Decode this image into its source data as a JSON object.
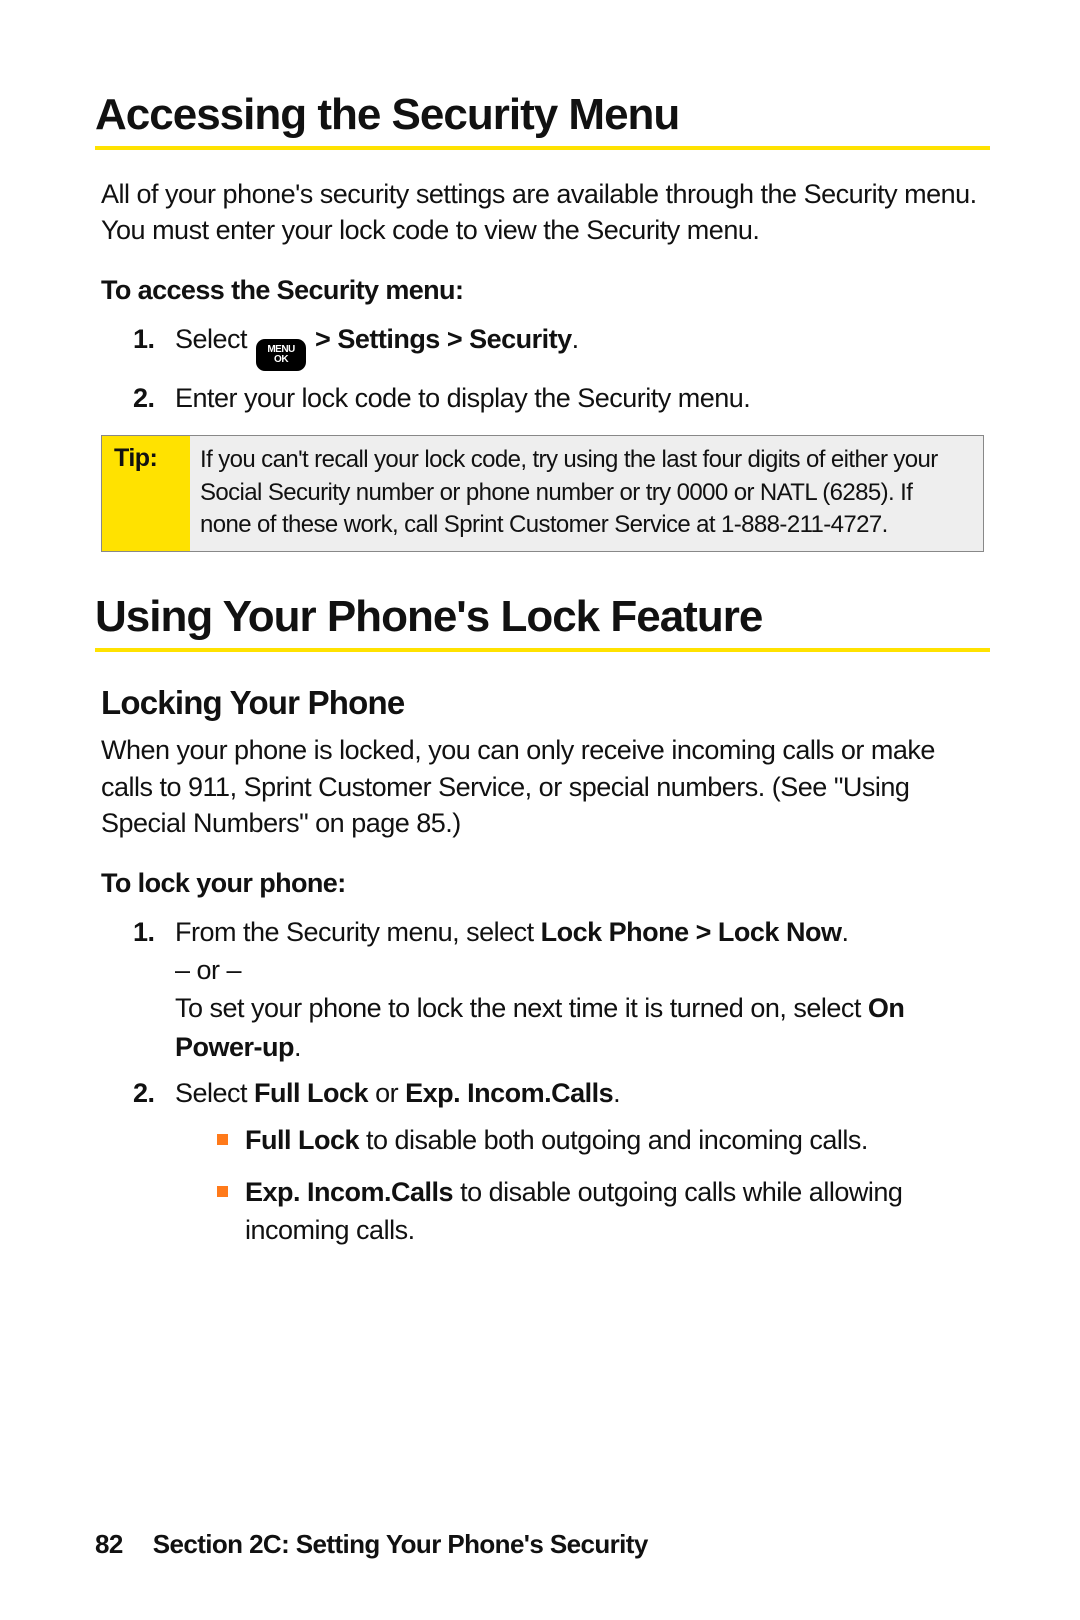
{
  "heading1": "Accessing the Security Menu",
  "intro1": "All of your phone's security settings are available through the Security menu. You must enter your lock code to view the Security menu.",
  "sub1": "To access the Security menu:",
  "steps1": {
    "n1": "1.",
    "s1_pre": "Select ",
    "s1_key_top": "MENU",
    "s1_key_bot": "OK",
    "s1_post": " > Settings > Security",
    "s1_dot": ".",
    "n2": "2.",
    "s2": "Enter your lock code to display the Security menu."
  },
  "tip_label": "Tip:",
  "tip_body": "If you can't recall your lock code, try using the last four digits of either your Social Security number or phone number or try 0000 or NATL (6285). If none of these work, call Sprint Customer Service at 1-888-211-4727.",
  "heading2": "Using Your Phone's Lock Feature",
  "h2a": "Locking Your Phone",
  "intro2": "When your phone is locked, you can only receive incoming calls or make calls to 911, Sprint Customer Service, or special numbers. (See \"Using Special Numbers\" on page 85.)",
  "sub2": "To lock your phone:",
  "steps2": {
    "n1": "1.",
    "s1_a": "From the Security menu, select ",
    "s1_b": "Lock Phone > Lock Now",
    "s1_b2": ".",
    "s1_or": "– or –",
    "s1_c": "To set your phone to lock the next time it is turned on, select ",
    "s1_d": "On Power-up",
    "s1_d2": ".",
    "n2": "2.",
    "s2_a": "Select ",
    "s2_b": "Full Lock",
    "s2_c": " or ",
    "s2_d": "Exp. Incom.Calls",
    "s2_e": "."
  },
  "bullets": {
    "b1a": "Full Lock",
    "b1b": " to disable both outgoing and incoming calls.",
    "b2a": "Exp. Incom.Calls",
    "b2b": " to disable outgoing calls while allowing incoming calls."
  },
  "footer_page": "82",
  "footer_text": "Section 2C: Setting Your Phone's Security"
}
